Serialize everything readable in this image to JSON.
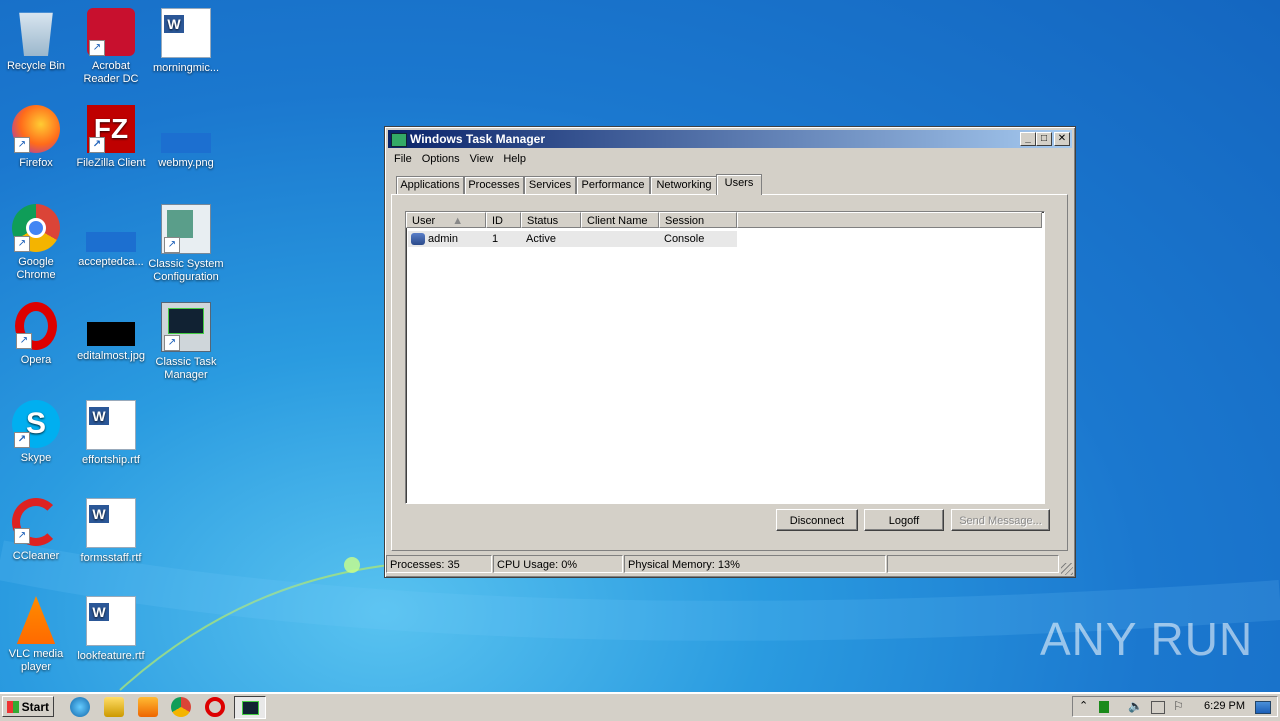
{
  "desktop": {
    "icons": [
      {
        "label": "Recycle Bin"
      },
      {
        "label": "Acrobat Reader DC"
      },
      {
        "label": "morningmic..."
      },
      {
        "label": "Firefox"
      },
      {
        "label": "FileZilla Client"
      },
      {
        "label": "webmy.png"
      },
      {
        "label": "Google Chrome"
      },
      {
        "label": "acceptedca..."
      },
      {
        "label": "Classic System Configuration"
      },
      {
        "label": "Opera"
      },
      {
        "label": "editalmost.jpg"
      },
      {
        "label": "Classic Task Manager"
      },
      {
        "label": "Skype"
      },
      {
        "label": "effortship.rtf"
      },
      {
        "label": "CCleaner"
      },
      {
        "label": "formsstaff.rtf"
      },
      {
        "label": "VLC media player"
      },
      {
        "label": "lookfeature.rtf"
      }
    ]
  },
  "window": {
    "title": "Windows Task Manager",
    "menu": [
      "File",
      "Options",
      "View",
      "Help"
    ],
    "tabs": [
      "Applications",
      "Processes",
      "Services",
      "Performance",
      "Networking",
      "Users"
    ],
    "active_tab": "Users",
    "columns": [
      "User",
      "ID",
      "Status",
      "Client Name",
      "Session"
    ],
    "rows": [
      {
        "user": "admin",
        "id": "1",
        "status": "Active",
        "client_name": "",
        "session": "Console"
      }
    ],
    "buttons": {
      "disconnect": "Disconnect",
      "logoff": "Logoff",
      "send_message": "Send Message..."
    },
    "status": {
      "processes": "Processes: 35",
      "cpu": "CPU Usage: 0%",
      "memory": "Physical Memory: 13%"
    }
  },
  "taskbar": {
    "start_label": "Start",
    "clock": "6:29 PM"
  },
  "watermark": "ANY RUN"
}
